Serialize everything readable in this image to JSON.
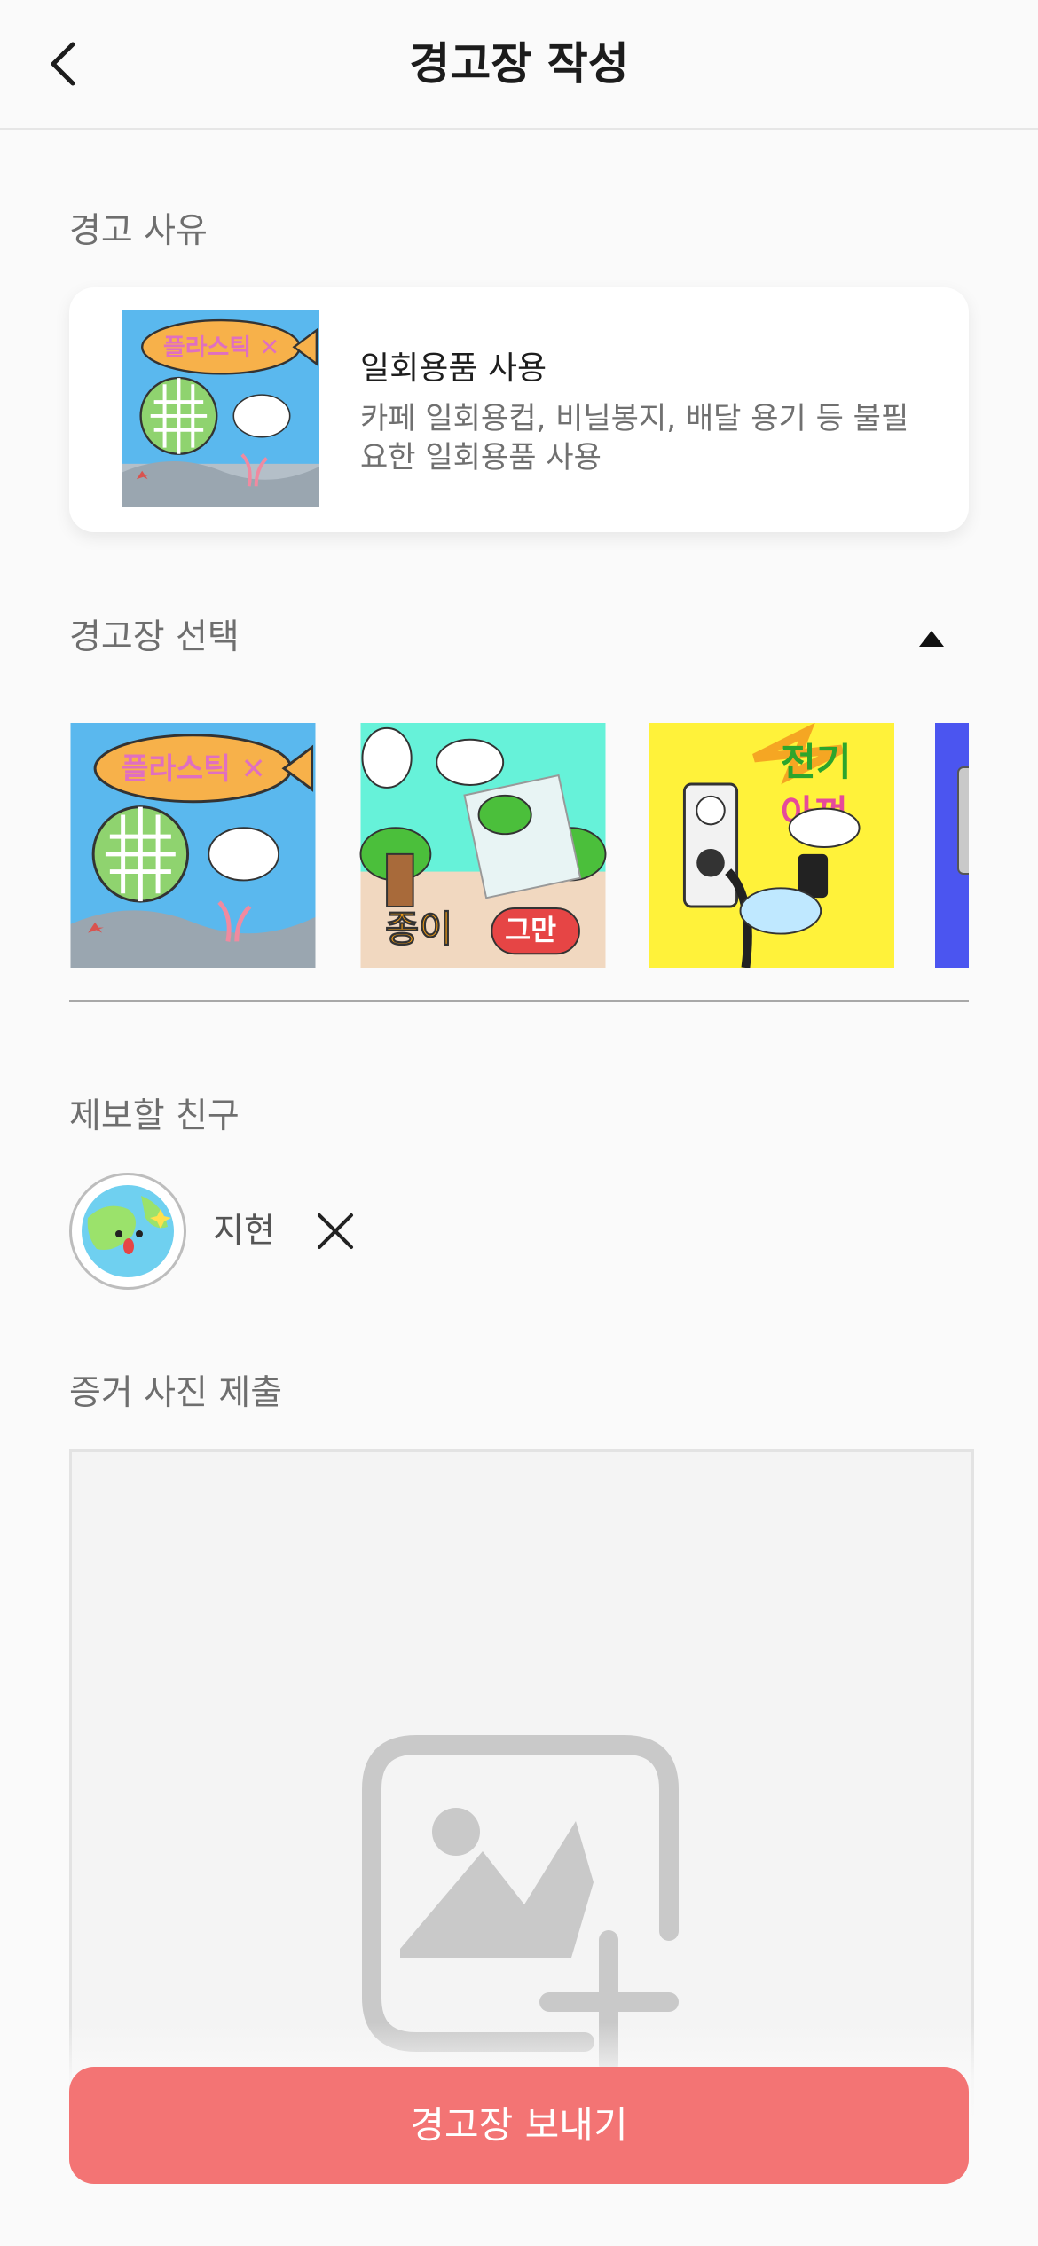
{
  "header": {
    "title": "경고장 작성"
  },
  "reason": {
    "label": "경고 사유",
    "title": "일회용품 사용",
    "description": "카페 일회용컵, 비닐봉지, 배달 용기 등 불필요한 일회용품 사용",
    "thumb_text": "플라스틱 ✕"
  },
  "select": {
    "label": "경고장 선택",
    "cards": [
      {
        "name": "plastic",
        "text": "플라스틱 ✕",
        "bg": "#5ab8ee"
      },
      {
        "name": "paper",
        "text_1": "종이",
        "text_2": "그만",
        "bg": "#66f2d9"
      },
      {
        "name": "electricity",
        "text_1": "전기",
        "text_2": "아껴",
        "bg": "#fff23a"
      },
      {
        "name": "partial",
        "bg": "#4b55f0"
      }
    ]
  },
  "friend": {
    "label": "제보할 친구",
    "name": "지현"
  },
  "photo": {
    "label": "증거 사진 제출"
  },
  "submit": {
    "label": "경고장 보내기"
  },
  "colors": {
    "accent": "#f37474",
    "card_bg": "#ffffff",
    "page_bg": "#fafafa"
  }
}
